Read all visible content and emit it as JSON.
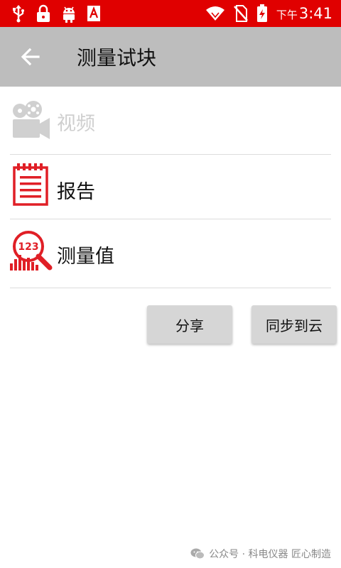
{
  "status_bar": {
    "icons_left": [
      "usb-icon",
      "lock-icon",
      "android-icon",
      "text-a-icon"
    ],
    "icons_right": [
      "wifi-icon",
      "no-sim-icon",
      "battery-charging-icon"
    ],
    "ampm": "下午",
    "time": "3:41"
  },
  "app_bar": {
    "title": "测量试块"
  },
  "menu": {
    "items": [
      {
        "label": "视频",
        "icon": "video-camera-icon",
        "enabled": false
      },
      {
        "label": "报告",
        "icon": "report-notepad-icon",
        "enabled": true
      },
      {
        "label": "测量值",
        "icon": "measurement-value-icon",
        "enabled": true
      }
    ]
  },
  "actions": {
    "share_label": "分享",
    "sync_label": "同步到云"
  },
  "watermark": {
    "text": "公众号 · 科电仪器 匠心制造"
  },
  "colors": {
    "status_bar": "#e00000",
    "app_bar": "#bdbdbd",
    "accent_red": "#e01f26",
    "disabled_gray": "#cfcfcf"
  }
}
